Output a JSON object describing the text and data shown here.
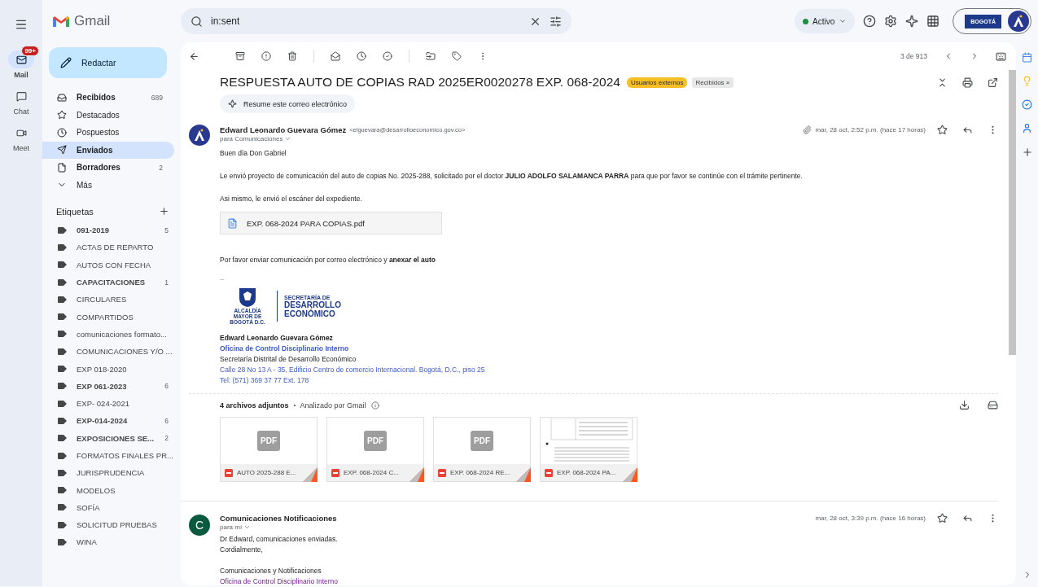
{
  "app": {
    "name": "Gmail"
  },
  "rail": [
    {
      "label": "Mail",
      "selected": true,
      "badge": "99+",
      "kind": "mail"
    },
    {
      "label": "Chat",
      "selected": false,
      "kind": "chat"
    },
    {
      "label": "Meet",
      "selected": false,
      "kind": "meet"
    }
  ],
  "compose": {
    "label": "Redactar"
  },
  "search": {
    "value": "in:sent"
  },
  "status": {
    "label": "Activo"
  },
  "account": {
    "org_logo": "BOGOTÁ"
  },
  "folders": [
    {
      "label": "Recibidos",
      "count": "689",
      "kind": "inbox",
      "selected": false,
      "unread": true
    },
    {
      "label": "Destacados",
      "kind": "star",
      "selected": false,
      "unread": false
    },
    {
      "label": "Pospuestos",
      "kind": "clock",
      "selected": false,
      "unread": false
    },
    {
      "label": "Enviados",
      "kind": "send",
      "selected": true,
      "unread": true
    },
    {
      "label": "Borradores",
      "count": "2",
      "kind": "file",
      "selected": false,
      "unread": true
    },
    {
      "label": "Más",
      "kind": "more",
      "selected": false,
      "unread": false
    }
  ],
  "labels_header": "Etiquetas",
  "labels": [
    {
      "label": "091-2019",
      "count": "5",
      "unread": true
    },
    {
      "label": "ACTAS DE REPARTO",
      "unread": false
    },
    {
      "label": "AUTOS CON FECHA",
      "unread": false
    },
    {
      "label": "CAPACITACIONES",
      "count": "1",
      "unread": true
    },
    {
      "label": "CIRCULARES",
      "unread": false
    },
    {
      "label": "COMPARTIDOS",
      "unread": false
    },
    {
      "label": "comunicaciones formato...",
      "unread": false
    },
    {
      "label": "COMUNICACIONES Y/O ...",
      "unread": false
    },
    {
      "label": "EXP 018-2020",
      "unread": false
    },
    {
      "label": "EXP 061-2023",
      "count": "6",
      "unread": true
    },
    {
      "label": "EXP- 024-2021",
      "unread": false
    },
    {
      "label": "EXP-014-2024",
      "count": "6",
      "unread": true
    },
    {
      "label": "EXPOSICIONES SE...",
      "count": "2",
      "unread": true
    },
    {
      "label": "FORMATOS FINALES PR...",
      "unread": false
    },
    {
      "label": "JURISPRUDENCIA",
      "unread": false
    },
    {
      "label": "MODELOS",
      "unread": false
    },
    {
      "label": "SOFÍA",
      "unread": false
    },
    {
      "label": "SOLICITUD PRUEBAS",
      "unread": false
    },
    {
      "label": "WINA",
      "unread": false
    }
  ],
  "pagination": "3 de 913",
  "thread": {
    "subject": "RESPUESTA AUTO DE COPIAS RAD 2025ER0020278 EXP. 068-2024",
    "tags": [
      {
        "label": "Usuarios externos",
        "kind": "highlight"
      },
      {
        "label": "Recibidos",
        "kind": "removable",
        "remove": "×"
      }
    ],
    "summarize": "Resume este correo electrónico"
  },
  "messages": [
    {
      "sender": "Edward Leonardo Guevara Gómez",
      "email": "<elguevara@desarrolloeconomico.gov.co>",
      "to": "para Comunicaciones",
      "date": "mar, 28 oct, 2:52 p.m. (hace 17 horas)",
      "has_attachment": true,
      "avatar": {
        "kind": "logo"
      },
      "body": [
        {
          "kind": "p",
          "text": "Buen día Don Gabriel"
        },
        {
          "kind": "p",
          "text": "Le envió proyecto de comunicación del auto de copias No. 2025-288, solicitado por el doctor  **JULIO ADOLFO SALAMANCA PARRA** para que por favor se continúe con el trámite pertinente."
        },
        {
          "kind": "p",
          "text": "Asi mismo, le envió el escáner del expediente."
        },
        {
          "kind": "chip",
          "text": "EXP. 068-2024 PARA COPIAS.pdf"
        },
        {
          "kind": "p",
          "text": "Por favor enviar comunicación por correo electrónico y **anexar el auto**"
        },
        {
          "kind": "dash",
          "text": "--"
        },
        {
          "kind": "logo",
          "seal_text": "ALCALDÍA MAYOR DE BOGOTÁ D.C.",
          "title_small": "SECRETARÍA DE",
          "title": "DESARROLLO ECONÓMICO"
        },
        {
          "kind": "strong",
          "text": "Edward Leonardo Guevara Gómez"
        },
        {
          "kind": "accent",
          "text": "Oficina de Control Disciplinario Interno"
        },
        {
          "kind": "line",
          "text": "Secretaría Distrital de Desarrollo Económico"
        },
        {
          "kind": "link",
          "text": "Calle 28 No 13 A - 35, Edificio Centro de comercio Internacional. Bogotá, D.C., piso 25"
        },
        {
          "kind": "link",
          "text": "Tel: (571) 369 37 77 Ext. 178"
        }
      ],
      "attachments": {
        "title": "4 archivos adjuntos",
        "scan": "Analizado por Gmail",
        "files": [
          {
            "name": "AUTO 2025-288 E...",
            "kind": "pdf",
            "badge": "PDF"
          },
          {
            "name": "EXP. 068-2024 C...",
            "kind": "pdf",
            "badge": "PDF"
          },
          {
            "name": "EXP. 068-2024 RE...",
            "kind": "pdf",
            "badge": "PDF"
          },
          {
            "name": "EXP. 068-2024 PA...",
            "kind": "preview"
          }
        ]
      }
    },
    {
      "sender": "Comunicaciones Notificaciones",
      "to": "para mí",
      "date": "mar, 28 oct, 3:39 p.m. (hace 16 horas)",
      "has_attachment": false,
      "avatar": {
        "kind": "letter",
        "letter": "C"
      },
      "body": [
        {
          "kind": "line",
          "text": "Dr Edward, comunicaciones enviadas."
        },
        {
          "kind": "line",
          "text": "Cordialmente,"
        },
        {
          "kind": "blank"
        },
        {
          "kind": "line",
          "text": "Comunicaciones y Notificaciones"
        },
        {
          "kind": "visited",
          "text": "Oficina de Control Disciplinario Interno"
        }
      ]
    }
  ]
}
